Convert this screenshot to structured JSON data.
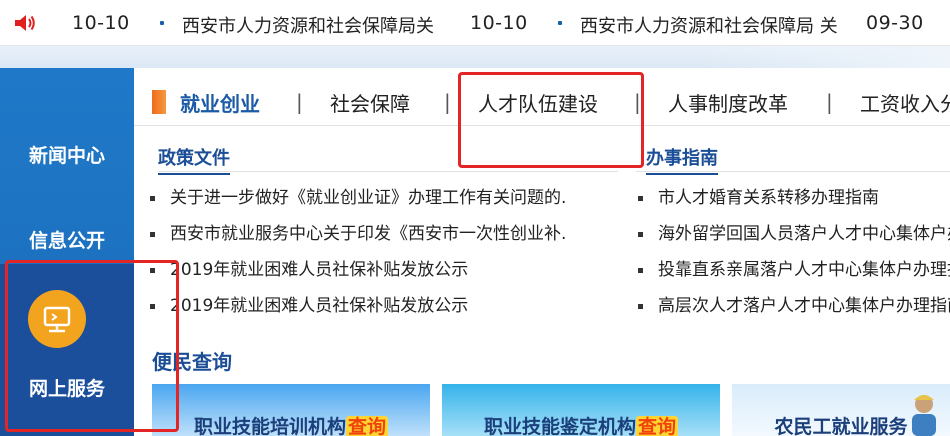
{
  "ticker": {
    "items": [
      {
        "date": "10-10",
        "title": "西安市人力资源和社会保障局关"
      },
      {
        "date": "10-10",
        "title": "西安市人力资源和社会保障局 关"
      },
      {
        "date": "09-30",
        "title": ""
      }
    ]
  },
  "leftnav": {
    "items": [
      "新闻中心",
      "信息公开",
      "网上服务"
    ]
  },
  "tabs": [
    "就业创业",
    "社会保障",
    "人才队伍建设",
    "人事制度改革",
    "工资收入分配"
  ],
  "tab_sep": "|",
  "policy": {
    "title": "政策文件",
    "items": [
      "关于进一步做好《就业创业证》办理工作有关问题的.",
      "西安市就业服务中心关于印发《西安市一次性创业补.",
      "2019年就业困难人员社保补贴发放公示",
      "2019年就业困难人员社保补贴发放公示"
    ]
  },
  "guide": {
    "title": "办事指南",
    "items": [
      "市人才婚育关系转移办理指南",
      "海外留学回国人员落户人才中心集体户办理指南",
      "投靠直系亲属落户人才中心集体户办理指南",
      "高层次人才落户人才中心集体户办理指南"
    ]
  },
  "convenience": {
    "title": "便民查询",
    "cards": [
      {
        "label": "职业技能培训机构",
        "highlight": "查询"
      },
      {
        "label": "职业技能鉴定机构",
        "highlight": "查询"
      },
      {
        "label": "农民工就业服务",
        "highlight": ""
      }
    ]
  },
  "colors": {
    "accent": "#1b4e96",
    "highlight_box": "#e42525",
    "nav_blue": "#1a6cb9",
    "online_orange": "#f3a41f"
  }
}
